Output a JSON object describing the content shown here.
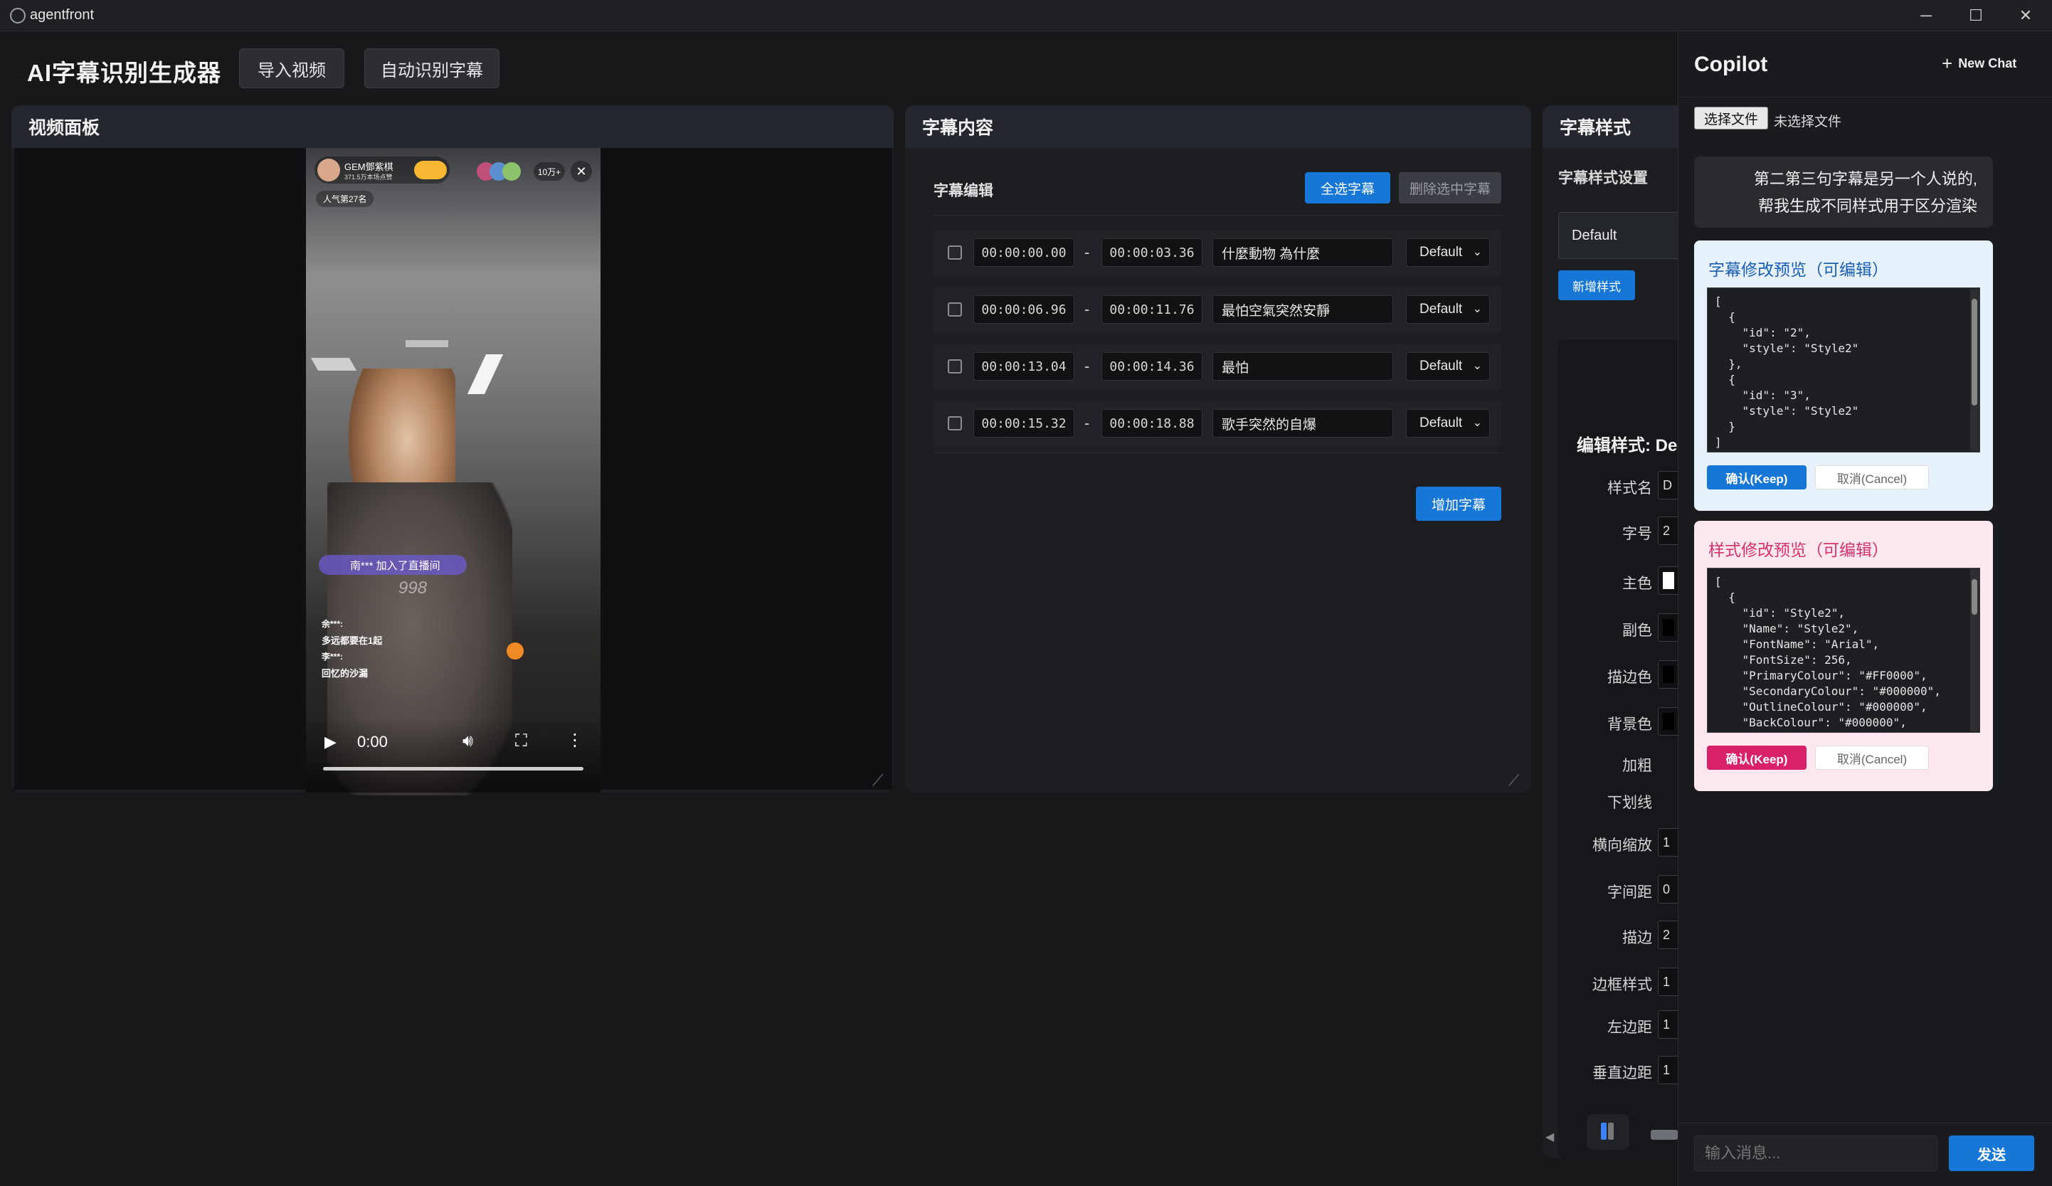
{
  "window": {
    "title": "agentfront",
    "controls": [
      "─",
      "☐",
      "✕"
    ]
  },
  "header": {
    "title": "AI字幕识别生成器",
    "import_label": "导入视频",
    "auto_label": "自动识别字幕"
  },
  "video_panel": {
    "title": "视频面板",
    "time": "0:00",
    "overlay": {
      "streamer": "GEM鄧紫棋",
      "followers": "371.5万本场点赞",
      "viewers": "10万+",
      "rank": "人气第27名",
      "join_msg": "南*** 加入了直播间",
      "comments": [
        {
          "user": "余***:",
          "text": "多远都要在1起"
        },
        {
          "user": "李***:",
          "text": "回忆的沙漏"
        }
      ],
      "gift_value": "998"
    }
  },
  "subtitle_panel": {
    "title": "字幕内容",
    "section": "字幕编辑",
    "select_all": "全选字幕",
    "delete_selected": "删除选中字幕",
    "add": "增加字幕",
    "rows": [
      {
        "start": "00:00:00.00",
        "end": "00:00:03.36",
        "text": "什麼動物 為什麼",
        "style": "Default"
      },
      {
        "start": "00:00:06.96",
        "end": "00:00:11.76",
        "text": "最怕空氣突然安靜",
        "style": "Default"
      },
      {
        "start": "00:00:13.04",
        "end": "00:00:14.36",
        "text": "最怕",
        "style": "Default"
      },
      {
        "start": "00:00:15.32",
        "end": "00:00:18.88",
        "text": "歌手突然的自爆",
        "style": "Default"
      }
    ]
  },
  "style_panel": {
    "title": "字幕样式",
    "section": "字幕样式设置",
    "current": "Default",
    "add_style": "新增样式",
    "edit_title": "编辑样式: De",
    "fields": [
      {
        "label": "样式名",
        "value": "D"
      },
      {
        "label": "字号",
        "value": "2"
      },
      {
        "label": "主色",
        "value": ""
      },
      {
        "label": "副色",
        "value": ""
      },
      {
        "label": "描边色",
        "value": ""
      },
      {
        "label": "背景色",
        "value": ""
      },
      {
        "label": "加粗",
        "value": ""
      },
      {
        "label": "下划线",
        "value": ""
      },
      {
        "label": "横向缩放",
        "value": "1"
      },
      {
        "label": "字间距",
        "value": "0"
      },
      {
        "label": "描边",
        "value": "2"
      },
      {
        "label": "边框样式",
        "value": "1"
      },
      {
        "label": "左边距",
        "value": "1"
      },
      {
        "label": "垂直边距",
        "value": "1"
      }
    ]
  },
  "copilot": {
    "title": "Copilot",
    "new_chat": "New Chat",
    "file_button": "选择文件",
    "file_status": "未选择文件",
    "user_msg_line1": "第二第三句字幕是另一个人说的,",
    "user_msg_line2": "帮我生成不同样式用于区分渲染",
    "sub_card": {
      "title": "字幕修改预览（可编辑）",
      "code": "[\n  {\n    \"id\": \"2\",\n    \"style\": \"Style2\"\n  },\n  {\n    \"id\": \"3\",\n    \"style\": \"Style2\"\n  }\n]",
      "keep": "确认(Keep)",
      "cancel": "取消(Cancel)"
    },
    "style_card": {
      "title": "样式修改预览（可编辑）",
      "code": "[\n  {\n    \"id\": \"Style2\",\n    \"Name\": \"Style2\",\n    \"FontName\": \"Arial\",\n    \"FontSize\": 256,\n    \"PrimaryColour\": \"#FF0000\",\n    \"SecondaryColour\": \"#000000\",\n    \"OutlineColour\": \"#000000\",\n    \"BackColour\": \"#000000\",",
      "keep": "确认(Keep)",
      "cancel": "取消(Cancel)"
    },
    "input_placeholder": "输入消息...",
    "send": "发送"
  },
  "colors": {
    "accent": "#1677d6",
    "sub_card_bg": "#e6f1fc",
    "sub_title": "#1a5fb4",
    "style_card_bg": "#fde7ef",
    "style_title": "#d6336c",
    "pink_btn": "#d9216a"
  }
}
